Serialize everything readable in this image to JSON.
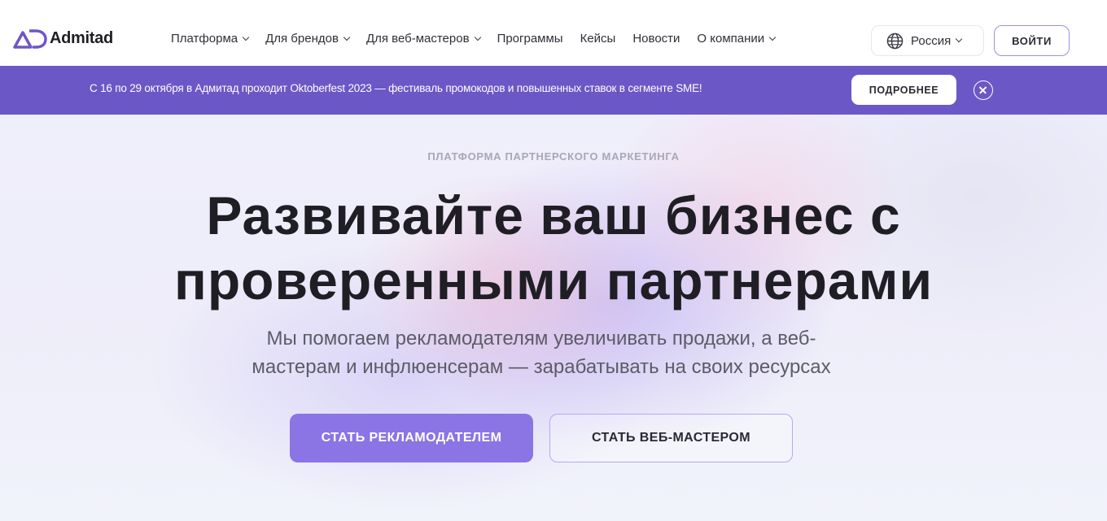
{
  "header": {
    "logo_text": "Admitad",
    "nav": [
      {
        "label": "Платформа",
        "has_dropdown": true
      },
      {
        "label": "Для брендов",
        "has_dropdown": true
      },
      {
        "label": "Для веб-мастеров",
        "has_dropdown": true
      },
      {
        "label": "Программы",
        "has_dropdown": false
      },
      {
        "label": "Кейсы",
        "has_dropdown": false
      },
      {
        "label": "Новости",
        "has_dropdown": false
      },
      {
        "label": "О компании",
        "has_dropdown": true
      }
    ],
    "region_label": "Россия",
    "login_label": "ВОЙТИ"
  },
  "banner": {
    "text": "С 16 по 29 октября в Адмитад проходит Oktoberfest 2023 — фестиваль промокодов и повышенных ставок в сегменте SME!",
    "button_label": "ПОДРОБНЕЕ"
  },
  "hero": {
    "eyebrow": "ПЛАТФОРМА ПАРТНЕРСКОГО МАРКЕТИНГА",
    "title_line1": "Развивайте ваш бизнес с",
    "title_line2": "проверенными партнерами",
    "subtitle_line1": "Мы помогаем рекламодателям увеличивать продажи, а веб-",
    "subtitle_line2": "мастерам и инфлюенсерам — зарабатывать на своих ресурсах",
    "primary_button": "СТАТЬ РЕКЛАМОДАТЕЛЕМ",
    "secondary_button": "СТАТЬ ВЕБ-МАСТЕРОМ"
  },
  "colors": {
    "brand": "#6c57c6",
    "primary_button": "#8b74e3",
    "outline": "#9d8ee6"
  },
  "icons": {
    "logo": "admitad-logo-icon",
    "region": "globe-icon",
    "dropdown": "chevron-down-icon",
    "close": "close-icon"
  }
}
